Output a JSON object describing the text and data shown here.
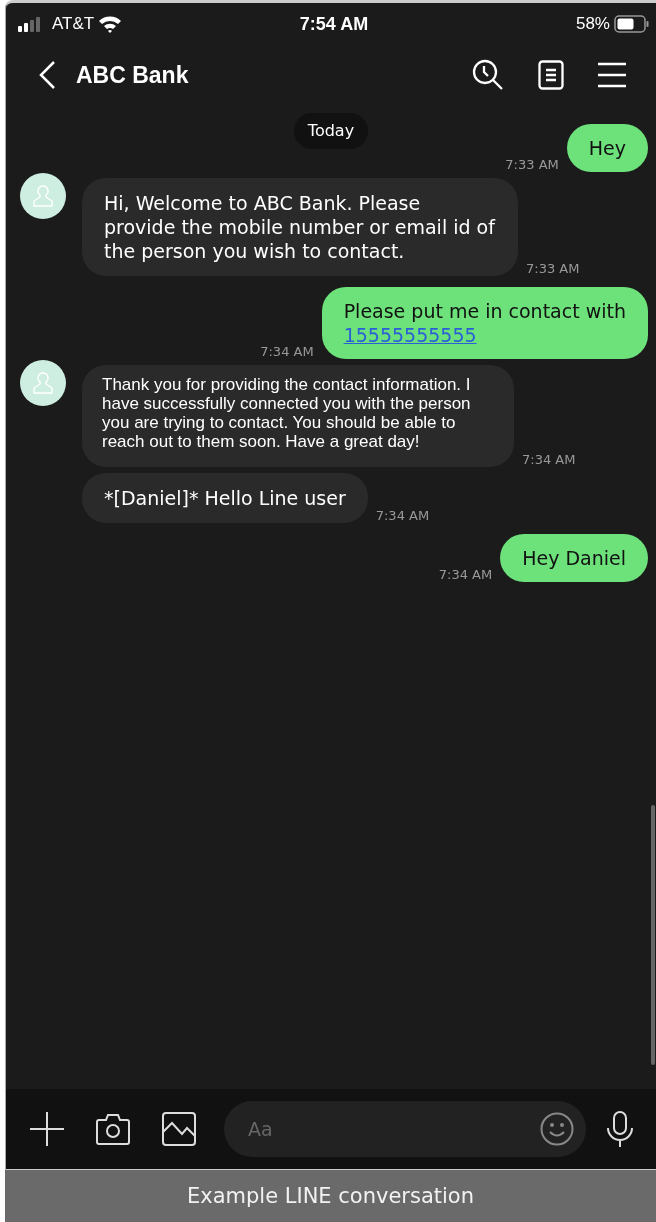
{
  "status_bar": {
    "carrier": "AT&T",
    "time": "7:54 AM",
    "battery": "58%"
  },
  "header": {
    "title": "ABC Bank"
  },
  "date_divider": "Today",
  "messages": [
    {
      "kind": "sent",
      "text": "Hey",
      "time": "7:33 AM"
    },
    {
      "kind": "received",
      "avatar": true,
      "text": "Hi, Welcome to ABC Bank. Please provide the mobile number or email id of the person you wish to contact.",
      "time": "7:33 AM"
    },
    {
      "kind": "sent",
      "text": "Please put me in contact with",
      "link": "15555555555",
      "time": "7:34 AM"
    },
    {
      "kind": "received",
      "avatar": true,
      "text": "Thank you for providing the contact information. I have successfully connected you with the person you are trying to contact. You should be able to reach out to them soon. Have a great day!",
      "time": "7:34 AM"
    },
    {
      "kind": "received",
      "avatar": false,
      "text": "*[Daniel]* Hello Line user",
      "time": "7:34 AM"
    },
    {
      "kind": "sent",
      "text": "Hey Daniel",
      "time": "7:34 AM"
    }
  ],
  "composer": {
    "placeholder": "Aa"
  },
  "caption": "Example LINE conversation"
}
